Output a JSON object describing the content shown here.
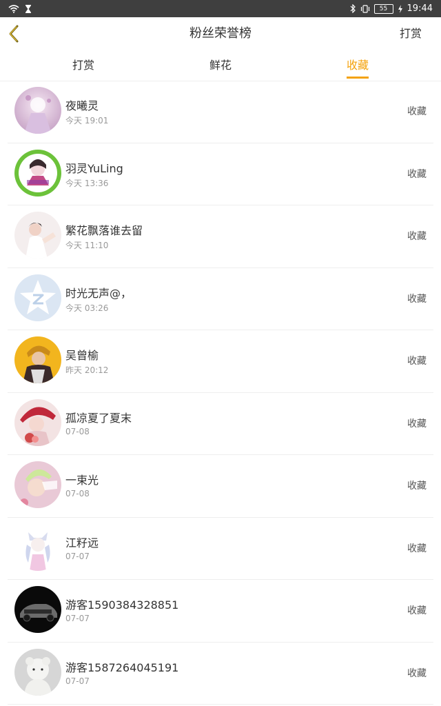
{
  "status_bar": {
    "time": "19:44",
    "battery": "55"
  },
  "header": {
    "title": "粉丝荣誉榜",
    "right_action": "打赏"
  },
  "tabs": [
    {
      "label": "打赏",
      "active": false
    },
    {
      "label": "鲜花",
      "active": false
    },
    {
      "label": "收藏",
      "active": true
    }
  ],
  "colors": {
    "accent": "#f4a20b",
    "text": "#333333",
    "muted": "#999999",
    "divider": "#eeeeee"
  },
  "fans": [
    {
      "name": "夜曦灵",
      "time": "今天 19:01",
      "action": "收藏"
    },
    {
      "name": "羽灵YuLing",
      "time": "今天 13:36",
      "action": "收藏"
    },
    {
      "name": "繁花飘落谁去留",
      "time": "今天 11:10",
      "action": "收藏"
    },
    {
      "name": "时光无声@，",
      "time": "今天 03:26",
      "action": "收藏"
    },
    {
      "name": "吴曾榆",
      "time": "昨天 20:12",
      "action": "收藏"
    },
    {
      "name": "孤凉夏了夏末",
      "time": "07-08",
      "action": "收藏"
    },
    {
      "name": "一束光",
      "time": "07-08",
      "action": "收藏"
    },
    {
      "name": "江籽远",
      "time": "07-07",
      "action": "收藏"
    },
    {
      "name": "游客1590384328851",
      "time": "07-07",
      "action": "收藏"
    },
    {
      "name": "游客1587264045191",
      "time": "07-07",
      "action": "收藏"
    }
  ]
}
